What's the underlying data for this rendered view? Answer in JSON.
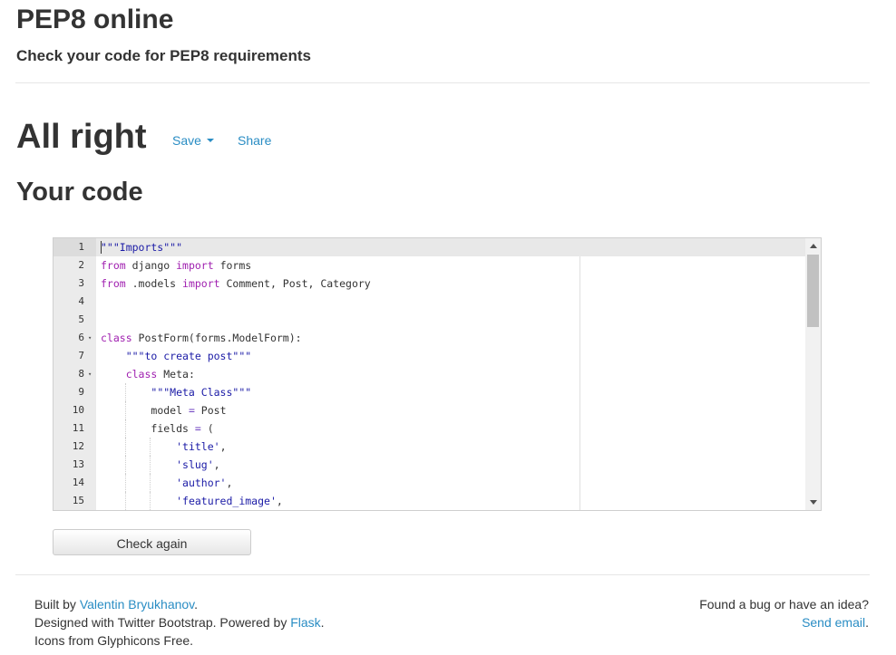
{
  "header": {
    "title": "PEP8 online",
    "subtitle": "Check your code for PEP8 requirements"
  },
  "result": {
    "title": "All right",
    "save_label": "Save",
    "share_label": "Share"
  },
  "code_section": {
    "heading": "Your code"
  },
  "editor": {
    "lines": [
      {
        "num": "1",
        "fold": ""
      },
      {
        "num": "2",
        "fold": ""
      },
      {
        "num": "3",
        "fold": ""
      },
      {
        "num": "4",
        "fold": ""
      },
      {
        "num": "5",
        "fold": ""
      },
      {
        "num": "6",
        "fold": "▾"
      },
      {
        "num": "7",
        "fold": ""
      },
      {
        "num": "8",
        "fold": "▾"
      },
      {
        "num": "9",
        "fold": ""
      },
      {
        "num": "10",
        "fold": ""
      },
      {
        "num": "11",
        "fold": ""
      },
      {
        "num": "12",
        "fold": ""
      },
      {
        "num": "13",
        "fold": ""
      },
      {
        "num": "14",
        "fold": ""
      },
      {
        "num": "15",
        "fold": ""
      }
    ],
    "code": {
      "l1_str": "\"\"\"Imports\"\"\"",
      "l2_kw1": "from",
      "l2_mod": " django ",
      "l2_kw2": "import",
      "l2_rest": " forms",
      "l3_kw1": "from",
      "l3_mod": " .models ",
      "l3_kw2": "import",
      "l3_rest": " Comment, Post, Category",
      "l6_kw": "class",
      "l6_rest": " PostForm(forms.ModelForm):",
      "l7_str": "\"\"\"to create post\"\"\"",
      "l8_kw": "class",
      "l8_rest": " Meta:",
      "l9_str": "\"\"\"Meta Class\"\"\"",
      "l10_a": "model ",
      "l10_op": "=",
      "l10_b": " Post",
      "l11_a": "fields ",
      "l11_op": "=",
      "l11_b": " (",
      "l12_str": "'title'",
      "l12_rest": ",",
      "l13_str": "'slug'",
      "l13_rest": ",",
      "l14_str": "'author'",
      "l14_rest": ",",
      "l15_str": "'featured_image'",
      "l15_rest": ","
    }
  },
  "actions": {
    "check_again_label": "Check again"
  },
  "footer": {
    "built_by_prefix": "Built by ",
    "author_link": "Valentin Bryukhanov",
    "built_by_suffix": ".",
    "designed_prefix": "Designed with Twitter Bootstrap. Powered by ",
    "flask_link": "Flask",
    "designed_suffix": ".",
    "icons_text": "Icons from Glyphicons Free.",
    "bug_text": "Found a bug or have an idea?",
    "email_link": "Send email",
    "email_suffix": "."
  },
  "colors": {
    "link": "#2a8dc4",
    "keyword": "#a020b0",
    "string": "#1a1aa6",
    "gutter": "#ebebeb",
    "active_line": "#e8e8e8"
  }
}
